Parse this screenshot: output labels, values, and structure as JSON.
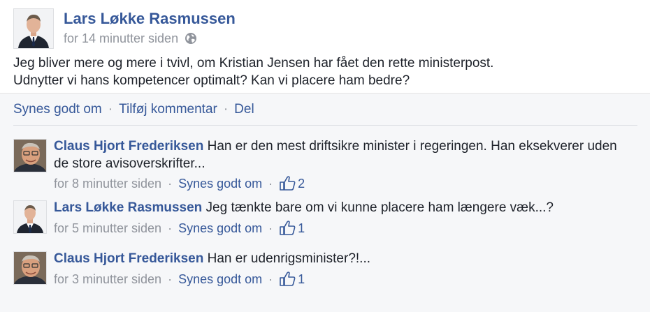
{
  "post": {
    "author": "Lars Løkke Rasmussen",
    "time": "for 14 minutter siden",
    "privacy_icon": "globe-icon",
    "text_lines": [
      "Jeg bliver mere og mere i tvivl, om Kristian Jensen har fået den rette ministerpost.",
      "Udnytter vi hans kompetencer optimalt? Kan vi placere ham bedre?"
    ]
  },
  "actions": {
    "like": "Synes godt om",
    "comment": "Tilføj kommentar",
    "share": "Del",
    "separator": "·"
  },
  "comments": [
    {
      "author": "Claus Hjort Frederiksen",
      "text": "Han er den mest driftsikre minister i regeringen. Han eksekverer uden de store avisoverskrifter...",
      "time": "for 8 minutter siden",
      "like_label": "Synes godt om",
      "likes": "2"
    },
    {
      "author": "Lars Løkke Rasmussen",
      "text": "Jeg tænkte bare om vi kunne placere ham længere væk...?",
      "time": "for 5 minutter siden",
      "like_label": "Synes godt om",
      "likes": "1"
    },
    {
      "author": "Claus Hjort Frederiksen",
      "text": "Han er udenrigsminister?!...",
      "time": "for 3 minutter siden",
      "like_label": "Synes godt om",
      "likes": "1"
    }
  ],
  "colors": {
    "link": "#365899",
    "meta": "#90949c",
    "feedback_bg": "#f6f7f9"
  }
}
